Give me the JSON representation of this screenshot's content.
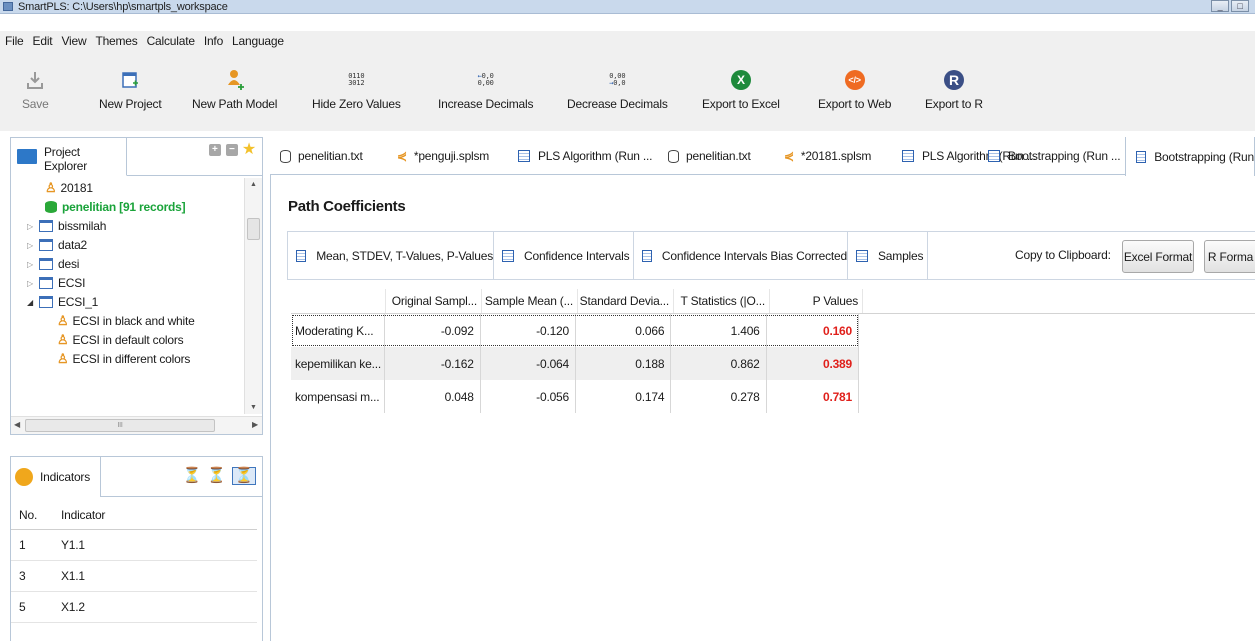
{
  "window": {
    "title": "SmartPLS: C:\\Users\\hp\\smartpls_workspace"
  },
  "menu": [
    "File",
    "Edit",
    "View",
    "Themes",
    "Calculate",
    "Info",
    "Language"
  ],
  "toolbar": {
    "save": "Save",
    "new_project": "New Project",
    "new_path_model": "New Path Model",
    "hide_zero": "Hide Zero Values",
    "hide_zero_icon_top": "0110",
    "hide_zero_icon_bottom": "3012",
    "increase_decimals": "Increase Decimals",
    "increase_icon_top": "0,0",
    "increase_icon_bottom": "0,00",
    "decrease_decimals": "Decrease Decimals",
    "decrease_icon_top": "0,00",
    "decrease_icon_bottom": "0,0",
    "export_excel": "Export to Excel",
    "export_web": "Export to Web",
    "export_r": "Export to R",
    "excel_glyph": "X",
    "web_glyph": "</>",
    "r_glyph": "R"
  },
  "project_explorer": {
    "title": "Project Explorer",
    "tools": {
      "expand": "+",
      "collapse": "−",
      "star": "★"
    },
    "items": [
      {
        "label": "20181",
        "type": "model",
        "indent": 1
      },
      {
        "label": "penelitian [91 records]",
        "type": "data",
        "indent": 1
      },
      {
        "label": "bissmilah",
        "type": "project",
        "indent": 0,
        "expander": "▷"
      },
      {
        "label": "data2",
        "type": "project",
        "indent": 0,
        "expander": "▷"
      },
      {
        "label": "desi",
        "type": "project",
        "indent": 0,
        "expander": "▷"
      },
      {
        "label": "ECSI",
        "type": "project",
        "indent": 0,
        "expander": "▷"
      },
      {
        "label": "ECSI_1",
        "type": "project",
        "indent": 0,
        "expander": "◢"
      },
      {
        "label": "ECSI in black and white",
        "type": "model",
        "indent": 1
      },
      {
        "label": "ECSI in default colors",
        "type": "model",
        "indent": 1
      },
      {
        "label": "ECSI in different colors",
        "type": "model",
        "indent": 1
      }
    ],
    "hscroll_grip": "III"
  },
  "indicators": {
    "title": "Indicators",
    "columns": {
      "no": "No.",
      "indicator": "Indicator"
    },
    "rows": [
      {
        "no": "1",
        "indicator": "Y1.1"
      },
      {
        "no": "3",
        "indicator": "X1.1"
      },
      {
        "no": "5",
        "indicator": "X1.2"
      }
    ]
  },
  "editor_tabs": [
    {
      "label": "penelitian.txt",
      "icon": "db"
    },
    {
      "label": "*penguji.splsm",
      "icon": "net"
    },
    {
      "label": "PLS Algorithm (Run ...",
      "icon": "grid"
    },
    {
      "label": "penelitian.txt",
      "icon": "db"
    },
    {
      "label": "*20181.splsm",
      "icon": "net"
    },
    {
      "label": "PLS Algorithm (Run ...",
      "icon": "grid"
    },
    {
      "label": "Bootstrapping (Run ...",
      "icon": "grid"
    },
    {
      "label": "Bootstrapping (Run",
      "icon": "grid",
      "active": true
    }
  ],
  "content": {
    "title": "Path Coefficients",
    "inner_tabs": [
      "Mean, STDEV, T-Values, P-Values",
      "Confidence Intervals",
      "Confidence Intervals Bias Corrected",
      "Samples"
    ],
    "copy_label": "Copy to Clipboard:",
    "excel_format": "Excel Format",
    "r_format": "R Forma",
    "columns": [
      "",
      "Original Sampl...",
      "Sample Mean (...",
      "Standard Devia...",
      "T Statistics (|O...",
      "P Values"
    ],
    "rows": [
      {
        "name": "Moderating K...",
        "original": "-0.092",
        "mean": "-0.120",
        "stdev": "0.066",
        "t": "1.406",
        "p": "0.160"
      },
      {
        "name": "kepemilikan ke...",
        "original": "-0.162",
        "mean": "-0.064",
        "stdev": "0.188",
        "t": "0.862",
        "p": "0.389"
      },
      {
        "name": "kompensasi m...",
        "original": "0.048",
        "mean": "-0.056",
        "stdev": "0.174",
        "t": "0.278",
        "p": "0.781"
      }
    ],
    "p_value_color": "#e0201b"
  },
  "colors": {
    "excel": "#1e8a3c",
    "web": "#ef6b22",
    "r": "#3b4f86",
    "green_text": "#1aa33a"
  }
}
